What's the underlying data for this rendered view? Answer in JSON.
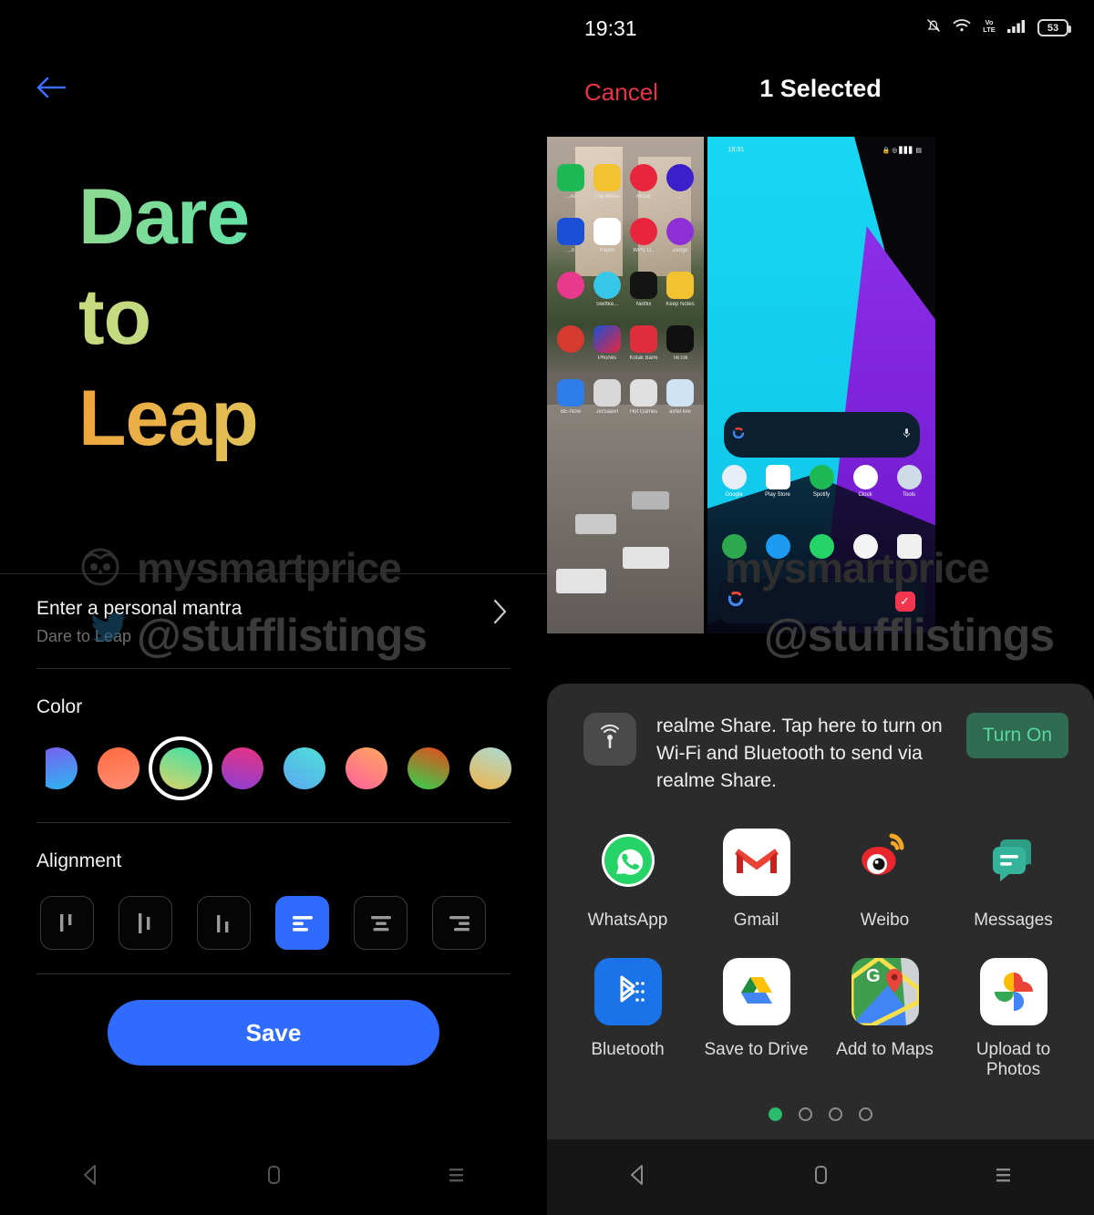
{
  "left_panel": {
    "back_icon": "arrow-left-icon",
    "hero": {
      "line1": "Dare",
      "line2": "to",
      "line3": "Leap"
    },
    "mantra_row": {
      "label": "Enter a personal mantra",
      "value": "Dare to Leap",
      "chevron": "chevron-right-icon"
    },
    "color_section": {
      "title": "Color",
      "selected_index": 2,
      "swatches": [
        {
          "name": "purple-blue",
          "from": "#7b5cf0",
          "to": "#2bb7f0"
        },
        {
          "name": "orange-salmon",
          "from": "#ff6a3d",
          "to": "#ff8f77"
        },
        {
          "name": "yellow-teal",
          "from": "#d8d46a",
          "to": "#3fe0a8"
        },
        {
          "name": "magenta-purple",
          "from": "#e8327f",
          "to": "#8c3fd6"
        },
        {
          "name": "blue-cyan",
          "from": "#5aa8f0",
          "to": "#4fe0d8"
        },
        {
          "name": "pink-orange",
          "from": "#ff5f9e",
          "to": "#ffa95c"
        },
        {
          "name": "green-red",
          "from": "#2fd44f",
          "to": "#e8481a"
        },
        {
          "name": "cyan-gold",
          "from": "#a9dcd8",
          "to": "#f0b44a"
        }
      ]
    },
    "alignment_section": {
      "title": "Alignment",
      "selected_index": 3,
      "options": [
        "vertical-align-top-icon",
        "vertical-align-middle-icon",
        "vertical-align-bottom-icon",
        "align-left-icon",
        "align-center-icon",
        "align-right-icon"
      ]
    },
    "save_label": "Save",
    "nav": {
      "back": "nav-back-icon",
      "home": "nav-home-icon",
      "recents": "nav-recents-icon"
    }
  },
  "right_panel": {
    "status_bar": {
      "clock": "19:31",
      "icons": [
        "bell-mute-icon",
        "wifi-icon",
        "volte-icon",
        "signal-icon",
        "battery-icon"
      ],
      "battery_level": "53"
    },
    "top_bar": {
      "cancel_label": "Cancel",
      "title": "1 Selected"
    },
    "thumbnails": [
      {
        "name": "screenshot-app-drawer",
        "selected": false,
        "drawer_apps": [
          "...As",
          "File Mana",
          "...",
          "Music",
          "...",
          "...n",
          "Paytm",
          "WPS O..",
          "Zedge",
          "Swiftke...",
          "Netflix",
          "Keep Notes",
          "Phones",
          "Kotak Bank",
          "TikTok",
          "BE-Now",
          "JioSaavn",
          "Hot Games",
          "airtel live"
        ]
      },
      {
        "name": "screenshot-home-screen",
        "selected": true,
        "status_clock": "19:31",
        "apps": [
          "Google",
          "Play Store",
          "Spotify",
          "Clock",
          "Tools"
        ]
      }
    ],
    "share_banner": {
      "icon": "realme-share-icon",
      "text": "realme Share. Tap here to turn on Wi-Fi and Bluetooth to send via realme Share.",
      "button_label": "Turn On",
      "button_color": "#2e6b52",
      "button_text_color": "#57d79b"
    },
    "share_targets": [
      {
        "name": "whatsapp",
        "label": "WhatsApp",
        "icon": "whatsapp-icon"
      },
      {
        "name": "gmail",
        "label": "Gmail",
        "icon": "gmail-icon"
      },
      {
        "name": "weibo",
        "label": "Weibo",
        "icon": "weibo-icon"
      },
      {
        "name": "messages",
        "label": "Messages",
        "icon": "messages-icon"
      },
      {
        "name": "bluetooth",
        "label": "Bluetooth",
        "icon": "bluetooth-icon"
      },
      {
        "name": "save-to-drive",
        "label": "Save to Drive",
        "icon": "google-drive-icon"
      },
      {
        "name": "add-to-maps",
        "label": "Add to Maps",
        "icon": "google-maps-icon"
      },
      {
        "name": "upload-to-photos",
        "label": "Upload to Photos",
        "icon": "google-photos-icon"
      }
    ],
    "pagination": {
      "total": 4,
      "active": 1
    },
    "nav": {
      "back": "nav-back-icon",
      "home": "nav-home-icon",
      "recents": "nav-recents-icon"
    }
  },
  "watermarks": {
    "brand": "mysmartprice",
    "handle": "@stufflistings"
  }
}
